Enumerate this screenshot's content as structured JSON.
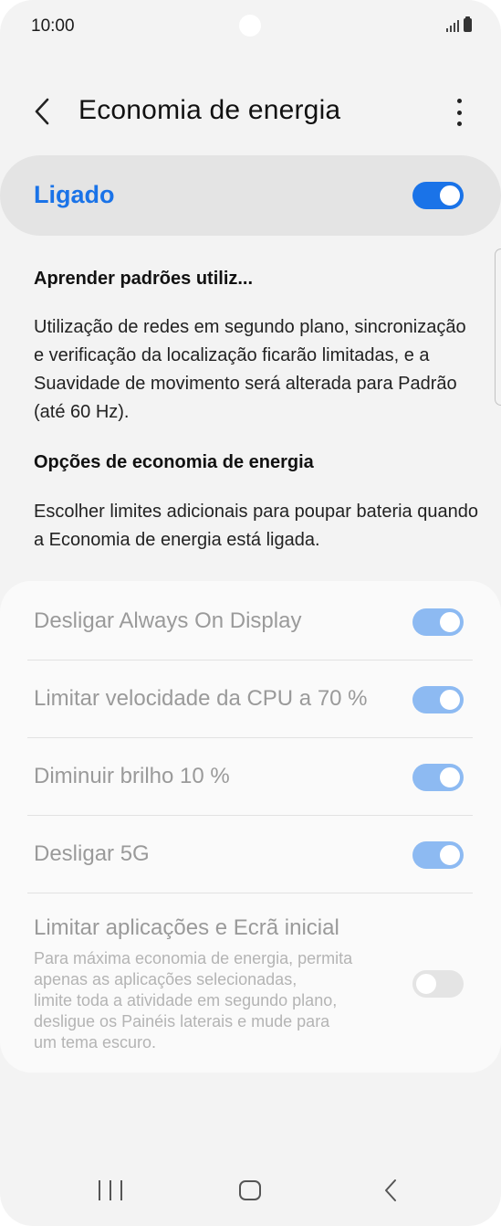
{
  "status_bar": {
    "time": "10:00"
  },
  "header": {
    "title": "Economia de energia"
  },
  "master_switch": {
    "label": "Ligado",
    "state": "on"
  },
  "learn_patterns": {
    "title": "Aprender padrões utiliz...",
    "description": "Utilização de redes em segundo plano, sincronização e verificação da localização ficarão limitadas, e a Suavidade de movimento será alterada para Padrão (até 60 Hz)."
  },
  "options_section": {
    "title": "Opções de economia de energia",
    "description": "Escolher limites adicionais para poupar bateria quando a Economia de energia está ligada."
  },
  "options": [
    {
      "label": "Desligar Always On Display",
      "state": "on"
    },
    {
      "label": "Limitar velocidade da CPU a 70 %",
      "state": "on"
    },
    {
      "label": "Diminuir brilho 10 %",
      "state": "on"
    },
    {
      "label": "Desligar 5G",
      "state": "on"
    },
    {
      "label": "Limitar aplicações e Ecrã inicial",
      "description_lines": [
        "Para máxima economia de energia, permita",
        "apenas as aplicações selecionadas,",
        "limite toda a atividade em segundo plano,",
        "desligue os Painéis laterais e mude para",
        "um tema escuro."
      ],
      "state": "off"
    }
  ],
  "colors": {
    "accent": "#1a73e8",
    "accent_disabled": "#8dbaf2",
    "background": "#f3f3f3",
    "card": "#fafafa"
  },
  "icons": [
    "back-arrow-icon",
    "more-options-icon",
    "signal-icon",
    "battery-icon",
    "recent-apps-icon",
    "home-icon",
    "nav-back-icon"
  ]
}
